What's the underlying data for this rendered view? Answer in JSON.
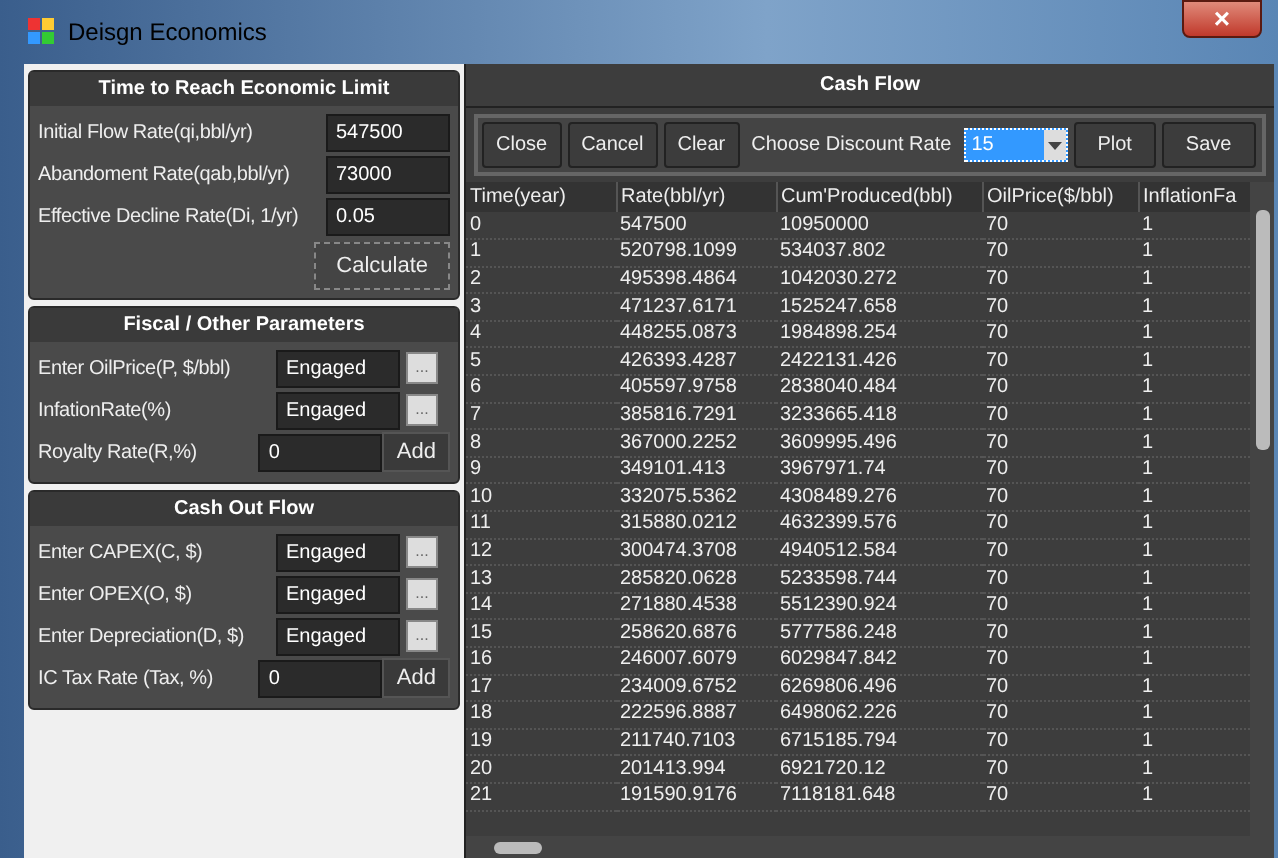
{
  "window": {
    "title": "Deisgn Economics",
    "close": "×"
  },
  "groups": [
    {
      "title": "Time to Reach Economic Limit",
      "fields": [
        {
          "kind": "text",
          "label": "Initial Flow Rate(qi,bbl/yr)",
          "value": "547500"
        },
        {
          "kind": "text",
          "label": "Abandoment Rate(qab,bbl/yr)",
          "value": "73000"
        },
        {
          "kind": "text",
          "label": "Effective Decline Rate(Di, 1/yr)",
          "value": "0.05"
        }
      ],
      "button": "Calculate"
    },
    {
      "title": "Fiscal / Other Parameters",
      "fields": [
        {
          "kind": "browse",
          "label": "Enter OilPrice(P, $/bbl)",
          "value": "Engaged",
          "button": "..."
        },
        {
          "kind": "browse",
          "label": "InfationRate(%)",
          "value": "Engaged",
          "button": "..."
        },
        {
          "kind": "add",
          "label": "Royalty Rate(R,%)",
          "value": "0",
          "button": "Add"
        }
      ]
    },
    {
      "title": "Cash Out Flow",
      "fields": [
        {
          "kind": "browse",
          "label": "Enter CAPEX(C, $)",
          "value": "Engaged",
          "button": "..."
        },
        {
          "kind": "browse",
          "label": "Enter OPEX(O, $)",
          "value": "Engaged",
          "button": "..."
        },
        {
          "kind": "browse",
          "label": "Enter Depreciation(D, $)",
          "value": "Engaged",
          "button": "..."
        },
        {
          "kind": "add",
          "label": "IC Tax Rate (Tax, %)",
          "value": "0",
          "button": "Add"
        }
      ]
    }
  ],
  "cash_flow": {
    "title": "Cash Flow",
    "toolbar": {
      "buttons_left": [
        "Close",
        "Cancel",
        "Clear"
      ],
      "discount_label": "Choose Discount Rate",
      "discount_value": "15",
      "buttons_right": [
        "Plot",
        "Save"
      ]
    },
    "table": {
      "columns": [
        "Time(year)",
        "Rate(bbl/yr)",
        "Cum'Produced(bbl)",
        "OilPrice($/bbl)",
        "InflationFa"
      ],
      "rows": [
        [
          "0",
          "547500",
          "10950000",
          "70",
          "1"
        ],
        [
          "1",
          "520798.1099",
          "534037.802",
          "70",
          "1"
        ],
        [
          "2",
          "495398.4864",
          "1042030.272",
          "70",
          "1"
        ],
        [
          "3",
          "471237.6171",
          "1525247.658",
          "70",
          "1"
        ],
        [
          "4",
          "448255.0873",
          "1984898.254",
          "70",
          "1"
        ],
        [
          "5",
          "426393.4287",
          "2422131.426",
          "70",
          "1"
        ],
        [
          "6",
          "405597.9758",
          "2838040.484",
          "70",
          "1"
        ],
        [
          "7",
          "385816.7291",
          "3233665.418",
          "70",
          "1"
        ],
        [
          "8",
          "367000.2252",
          "3609995.496",
          "70",
          "1"
        ],
        [
          "9",
          "349101.413",
          "3967971.74",
          "70",
          "1"
        ],
        [
          "10",
          "332075.5362",
          "4308489.276",
          "70",
          "1"
        ],
        [
          "11",
          "315880.0212",
          "4632399.576",
          "70",
          "1"
        ],
        [
          "12",
          "300474.3708",
          "4940512.584",
          "70",
          "1"
        ],
        [
          "13",
          "285820.0628",
          "5233598.744",
          "70",
          "1"
        ],
        [
          "14",
          "271880.4538",
          "5512390.924",
          "70",
          "1"
        ],
        [
          "15",
          "258620.6876",
          "5777586.248",
          "70",
          "1"
        ],
        [
          "16",
          "246007.6079",
          "6029847.842",
          "70",
          "1"
        ],
        [
          "17",
          "234009.6752",
          "6269806.496",
          "70",
          "1"
        ],
        [
          "18",
          "222596.8887",
          "6498062.226",
          "70",
          "1"
        ],
        [
          "19",
          "211740.7103",
          "6715185.794",
          "70",
          "1"
        ],
        [
          "20",
          "201413.994",
          "6921720.12",
          "70",
          "1"
        ],
        [
          "21",
          "191590.9176",
          "7118181.648",
          "70",
          "1"
        ]
      ]
    }
  }
}
